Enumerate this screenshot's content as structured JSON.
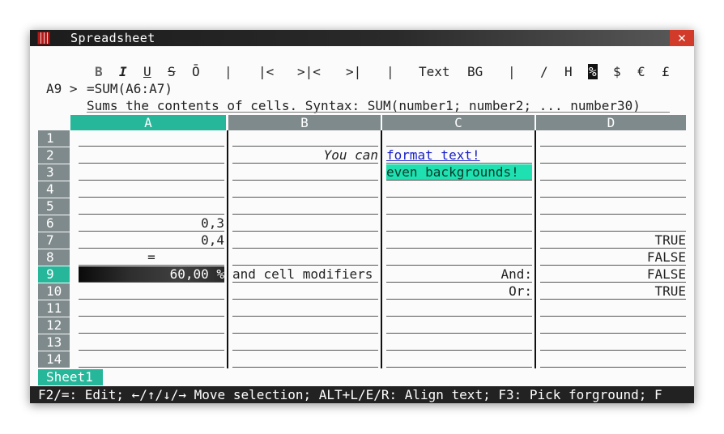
{
  "window": {
    "title": "Spreadsheet",
    "close_symbol": "✕"
  },
  "toolbar": {
    "bold": "B",
    "italic": "I",
    "underline": "U",
    "strike": "S",
    "overline": "Ō",
    "sep1": "|",
    "align_left": "|<",
    "align_center": ">|<",
    "align_right": ">|",
    "sep2": "|",
    "text_color": "Text",
    "bg_color": "BG",
    "sep3": "|",
    "fraction": "/",
    "hours": "H",
    "percent": "%",
    "dollar": "$",
    "euro": "€",
    "pound": "£"
  },
  "formula_bar": {
    "address": "A9 >",
    "formula": "=SUM(A6:A7)",
    "hint": "Sums the contents of cells. Syntax: SUM(number1; number2; ... number30)"
  },
  "columns": [
    "A",
    "B",
    "C",
    "D"
  ],
  "rows": [
    "1",
    "2",
    "3",
    "4",
    "5",
    "6",
    "7",
    "8",
    "9",
    "10",
    "11",
    "12",
    "13",
    "14"
  ],
  "active": {
    "column": "A",
    "row": "9"
  },
  "cells": {
    "B2": "You can",
    "C2": "format text!",
    "C3": "even backgrounds!",
    "A6": "0,3",
    "A7": "0,4",
    "D7": "TRUE",
    "A8": "=",
    "D8": "FALSE",
    "A9": "60,00 %",
    "B9": "and cell modifiers",
    "C9": "And:",
    "D9": "FALSE",
    "C10": "Or:",
    "D10": "TRUE"
  },
  "sheets": [
    "Sheet1"
  ],
  "status_bar": "F2/=: Edit; ←/↑/↓/→ Move selection; ALT+L/E/R: Align text; F3: Pick forground; F",
  "colors": {
    "accent": "#26b79a",
    "header_gray": "#7e8a8c",
    "bg_highlight": "#1ee0b0",
    "text_blue": "#1a20c8"
  }
}
